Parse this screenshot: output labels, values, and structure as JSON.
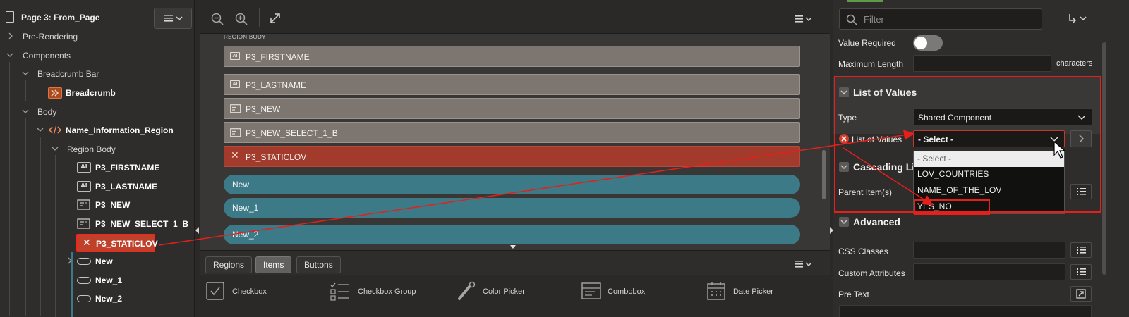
{
  "tree": {
    "page_title": "Page 3: From_Page",
    "nodes": {
      "pre_rendering": "Pre-Rendering",
      "components": "Components",
      "breadcrumb_bar": "Breadcrumb Bar",
      "breadcrumb": "Breadcrumb",
      "body": "Body",
      "region": "Name_Information_Region",
      "region_body": "Region Body",
      "firstname": "P3_FIRSTNAME",
      "lastname": "P3_LASTNAME",
      "new_item": "P3_NEW",
      "new_select": "P3_NEW_SELECT_1_B",
      "staticlov": "P3_STATICLOV",
      "btn_new": "New",
      "btn_new1": "New_1",
      "btn_new2": "New_2"
    },
    "item_icon_text": "AI"
  },
  "layout": {
    "region_body_label": "REGION BODY",
    "items": [
      "P3_FIRSTNAME",
      "P3_LASTNAME",
      "P3_NEW",
      "P3_NEW_SELECT_1_B",
      "P3_STATICLOV"
    ],
    "buttons": [
      "New",
      "New_1",
      "New_2"
    ],
    "gallery_tabs": [
      "Regions",
      "Items",
      "Buttons"
    ],
    "gallery_items": [
      "Checkbox",
      "Checkbox Group",
      "Color Picker",
      "Combobox",
      "Date Picker"
    ]
  },
  "properties": {
    "filter_placeholder": "Filter",
    "value_required_label": "Value Required",
    "max_length_label": "Maximum Length",
    "characters_label": "characters",
    "lov_section": "List of Values",
    "type_label": "Type",
    "type_value": "Shared Component",
    "lov_label": "List of Values",
    "lov_value": "- Select -",
    "lov_options": [
      "- Select -",
      "LOV_COUNTRIES",
      "NAME_OF_THE_LOV",
      "YES_NO"
    ],
    "cascading_section": "Cascading Lis",
    "parent_items_label": "Parent Item(s)",
    "advanced_section": "Advanced",
    "css_classes_label": "CSS Classes",
    "custom_attributes_label": "Custom Attributes",
    "pre_text_label": "Pre Text"
  },
  "colors": {
    "error_red": "#c0412a",
    "button_teal": "#3d7a88",
    "highlight_red": "#e61f1a",
    "accent_green": "#5f9b47"
  }
}
